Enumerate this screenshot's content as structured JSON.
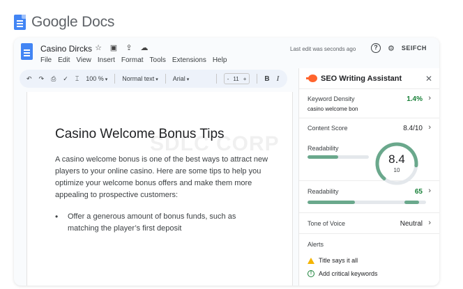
{
  "brand": {
    "name": "Google Docs"
  },
  "document": {
    "title": "Casino Dircks",
    "last_edit": "Last edit was seconds ago",
    "user_label": "SEIFCH",
    "menu": [
      "File",
      "Edit",
      "View",
      "Insert",
      "Format",
      "Tools",
      "Extensions",
      "Help"
    ],
    "heading": "Casino Welcome Bonus Tips",
    "watermark": "SDLC CORP",
    "paragraph": "A casino welcome bonus is one of the best ways to attract new players to your online casino. Here are some tips to help you optimize your welcome bonus offers and make them more appealing to prospective customers:",
    "bullets": [
      "Offer a generous amount of bonus funds, such as matching the player’s first deposit"
    ]
  },
  "toolbar": {
    "zoom": "100 %",
    "style": "Normal text",
    "font": "Arial",
    "font_size": "11",
    "decrease": "-",
    "increase": "+",
    "bold": "B",
    "italic": "I"
  },
  "icons": [
    "undo-icon",
    "redo-icon",
    "print-icon",
    "spellcheck-icon",
    "paint-format-icon",
    "star-icon",
    "move-icon",
    "share-icon",
    "cloud-icon",
    "help-icon",
    "settings-icon",
    "close-icon",
    "warning-icon",
    "check-circle-icon"
  ],
  "colors": {
    "accent": "#188038",
    "brand": "#4285f4",
    "semrush": "#ff642d",
    "bar": "#6aa88c",
    "warning": "#f4b400"
  },
  "seo_panel": {
    "title": "SEO Writing Assistant",
    "keyword_density": {
      "label": "Keyword Density",
      "value": "1.4%",
      "keyword": "casino welcome bon"
    },
    "content_score": {
      "label": "Content Score",
      "value": "8.4/10"
    },
    "readability_gauge": {
      "label": "Readability",
      "value": "8.4",
      "max": "10",
      "level": 0.84,
      "bar_level": 0.5
    },
    "readability": {
      "label": "Readability",
      "value": "65",
      "segments": [
        [
          0,
          0.4
        ],
        [
          0.82,
          0.12
        ]
      ]
    },
    "tone": {
      "label": "Tone of Voice",
      "value": "Neutral"
    },
    "alerts": {
      "label": "Alerts",
      "items": [
        "Title says it all",
        "Add critical keywords"
      ]
    }
  }
}
